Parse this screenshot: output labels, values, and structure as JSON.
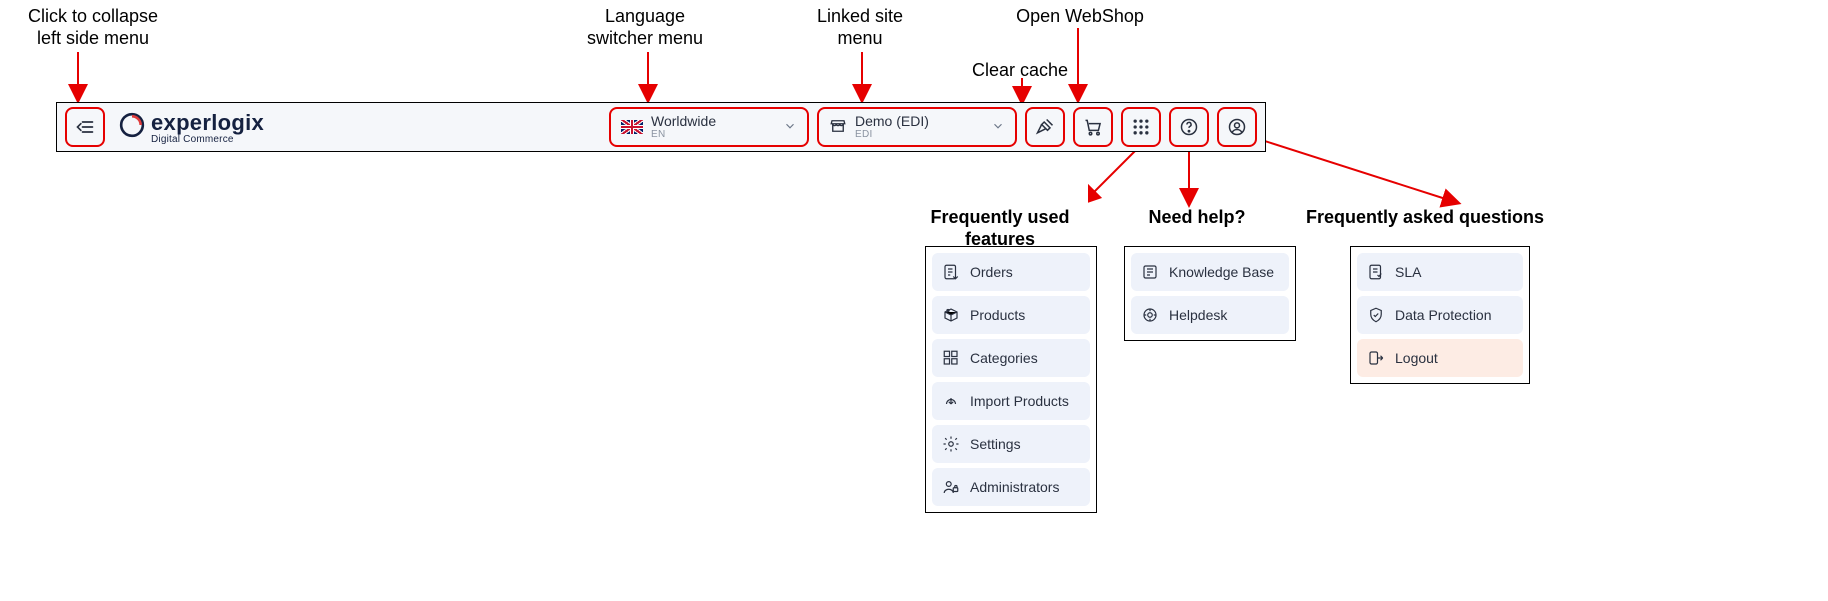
{
  "annotations": {
    "collapse": "Click to collapse\nleft side menu",
    "language": "Language\nswitcher menu",
    "linked_site": "Linked site\nmenu",
    "clear_cache": "Clear cache",
    "open_webshop": "Open WebShop",
    "freq_features": "Frequently used features",
    "need_help": "Need help?",
    "faq": "Frequently asked questions"
  },
  "header": {
    "brand": {
      "name": "experlogix",
      "tagline": "Digital Commerce"
    },
    "language": {
      "label": "Worldwide",
      "code": "EN"
    },
    "site": {
      "label": "Demo (EDI)",
      "code": "EDI"
    }
  },
  "freq": {
    "items": [
      {
        "icon": "orders",
        "label": "Orders"
      },
      {
        "icon": "products",
        "label": "Products"
      },
      {
        "icon": "categories",
        "label": "Categories"
      },
      {
        "icon": "import",
        "label": "Import Products"
      },
      {
        "icon": "settings",
        "label": "Settings"
      },
      {
        "icon": "admins",
        "label": "Administrators"
      }
    ]
  },
  "help": {
    "items": [
      {
        "icon": "kb",
        "label": "Knowledge Base"
      },
      {
        "icon": "helpdesk",
        "label": "Helpdesk"
      }
    ]
  },
  "faq": {
    "items": [
      {
        "icon": "sla",
        "label": "SLA"
      },
      {
        "icon": "dp",
        "label": "Data Protection"
      },
      {
        "icon": "logout",
        "label": "Logout",
        "variant": "orange"
      }
    ]
  }
}
